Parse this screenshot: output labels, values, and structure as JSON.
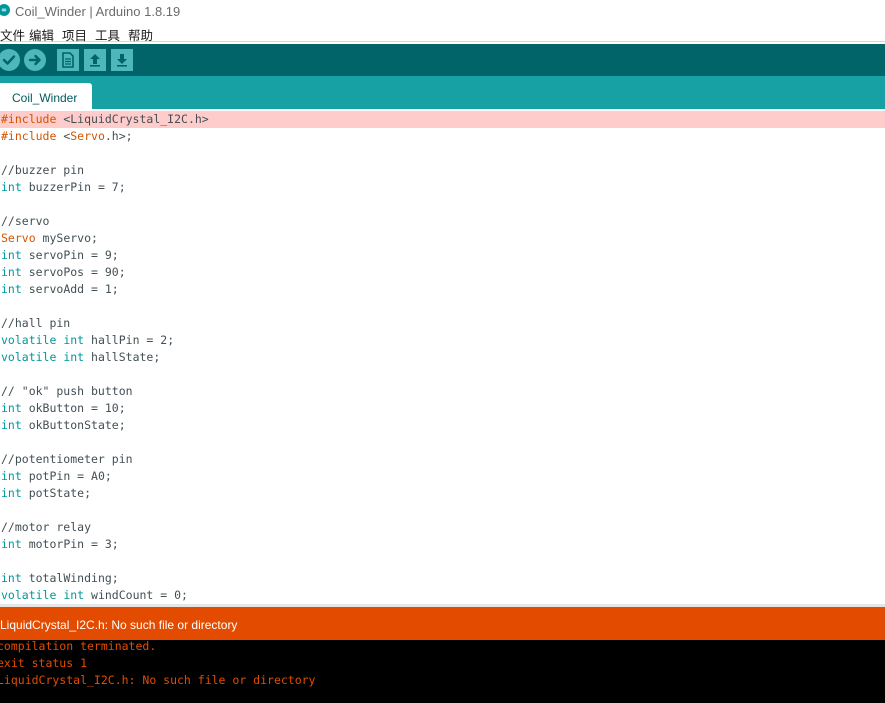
{
  "window": {
    "icon": "arduino-logo-icon",
    "title": "Coil_Winder | Arduino 1.8.19"
  },
  "menu": [
    "文件",
    "编辑",
    "项目",
    "工具",
    "帮助"
  ],
  "toolbar": {
    "buttons": [
      "verify-icon",
      "upload-icon",
      "new-file-icon",
      "open-icon",
      "save-icon"
    ]
  },
  "tab": {
    "label": "Coil_Winder"
  },
  "code": [
    "#include <LiquidCrystal_I2C.h>",
    "#include <Servo.h>;",
    "",
    "//buzzer pin",
    "int buzzerPin = 7;",
    "",
    "//servo",
    "Servo myServo;",
    "int servoPin = 9;",
    "int servoPos = 90;",
    "int servoAdd = 1;",
    "",
    "//hall pin",
    "volatile int hallPin = 2;",
    "volatile int hallState;",
    "",
    "// \"ok\" push button",
    "int okButton = 10;",
    "int okButtonState;",
    "",
    "//potentiometer pin",
    "int potPin = A0;",
    "int potState;",
    "",
    "//motor relay",
    "int motorPin = 3;",
    "",
    "int totalWinding;",
    "volatile int windCount = 0;"
  ],
  "status": {
    "message": "LiquidCrystal_I2C.h: No such file or directory"
  },
  "console": [
    "compilation terminated.",
    "exit status 1",
    "LiquidCrystal_I2C.h: No such file or directory"
  ],
  "colors": {
    "toolbar": "#006468",
    "tabstrip": "#17a1a5",
    "error_bar": "#e34c00",
    "console_bg": "#000000",
    "highlight_line": "#ffcccc",
    "keyword": "#5e6d03",
    "type": "#00979c",
    "library": "#d35400"
  }
}
